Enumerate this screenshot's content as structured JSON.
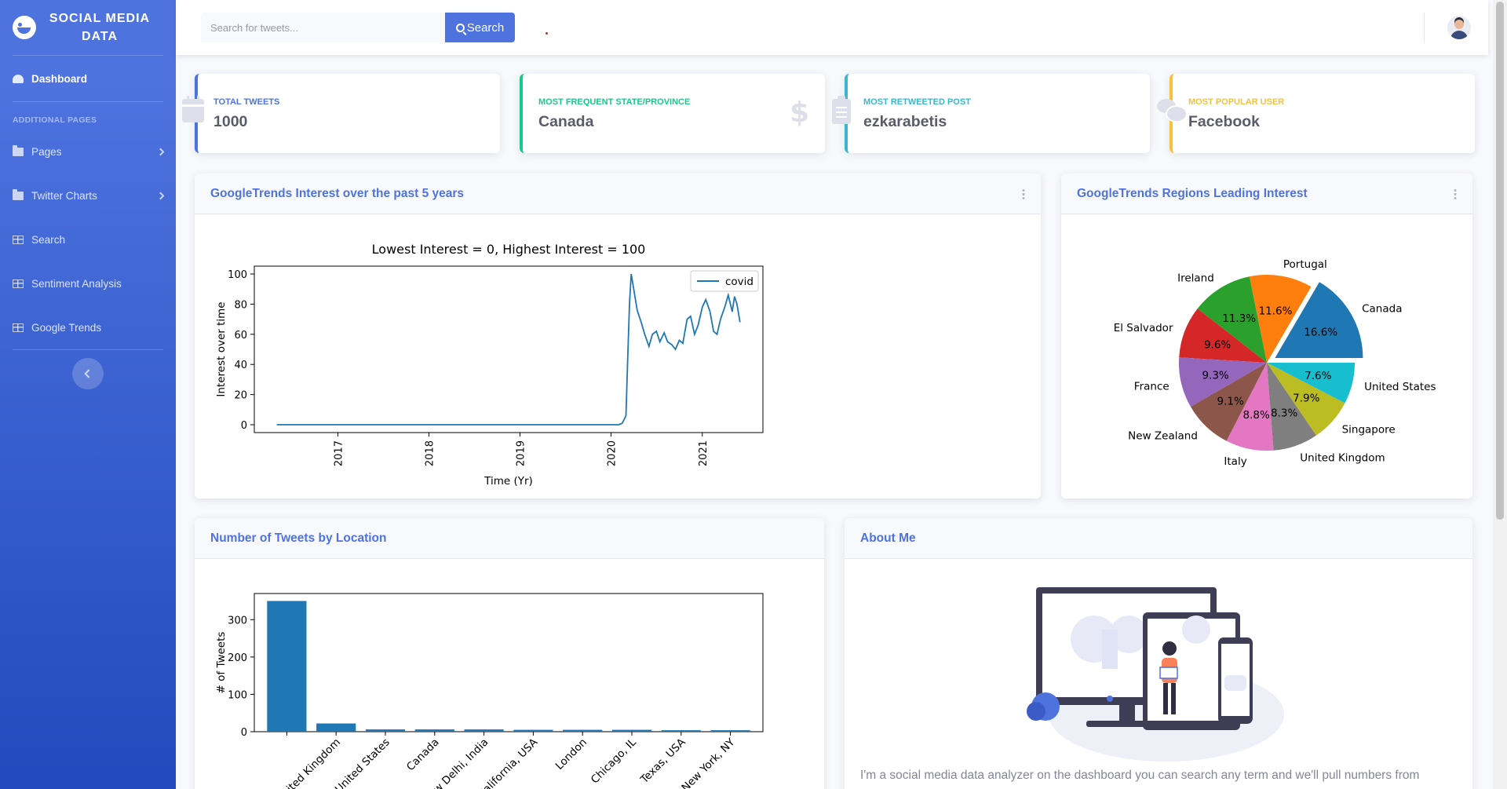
{
  "sidebar": {
    "brand": "SOCIAL MEDIA DATA",
    "items": [
      {
        "label": "Dashboard"
      },
      {
        "label": "Pages"
      },
      {
        "label": "Twitter Charts"
      },
      {
        "label": "Search"
      },
      {
        "label": "Sentiment Analysis"
      },
      {
        "label": "Google Trends"
      }
    ],
    "heading": "ADDITIONAL PAGES"
  },
  "topbar": {
    "search_placeholder": "Search for tweets...",
    "search_button": "Search"
  },
  "stats": [
    {
      "label": "TOTAL TWEETS",
      "value": "1000",
      "color": "#4e73df",
      "icon": "calendar-icon"
    },
    {
      "label": "MOST FREQUENT STATE/PROVINCE",
      "value": "Canada",
      "color": "#1cc88a",
      "icon": "dollar-icon"
    },
    {
      "label": "MOST RETWEETED POST",
      "value": "ezkarabetis",
      "color": "#36b9cc",
      "icon": "clipboard-icon"
    },
    {
      "label": "MOST POPULAR USER",
      "value": "Facebook",
      "color": "#f6c23e",
      "icon": "comments-icon"
    }
  ],
  "panels": {
    "trends_title": "GoogleTrends Interest over the past 5 years",
    "regions_title": "GoogleTrends Regions Leading Interest",
    "location_title": "Number of Tweets by Location",
    "about_title": "About Me",
    "about_text": "I'm a social media data analyzer on the dashboard you can search any term and we'll pull numbers from"
  },
  "chart_data": [
    {
      "type": "line",
      "title": "Lowest Interest = 0, Highest Interest = 100",
      "xlabel": "Time (Yr)",
      "ylabel": "Interest over time",
      "x_ticks": [
        "2017",
        "2018",
        "2019",
        "2020",
        "2021"
      ],
      "y_ticks": [
        0,
        20,
        40,
        60,
        80,
        100
      ],
      "ylim": [
        0,
        100
      ],
      "legend": "top-right",
      "series": [
        {
          "name": "covid",
          "color": "#1f77b4",
          "points": [
            [
              "2016-05-01",
              0
            ],
            [
              "2017-01-01",
              0
            ],
            [
              "2018-01-01",
              0
            ],
            [
              "2019-01-01",
              0
            ],
            [
              "2020-01-01",
              0
            ],
            [
              "2020-02-01",
              0
            ],
            [
              "2020-02-15",
              1
            ],
            [
              "2020-03-01",
              6
            ],
            [
              "2020-03-08",
              45
            ],
            [
              "2020-03-15",
              80
            ],
            [
              "2020-03-22",
              100
            ],
            [
              "2020-04-01",
              90
            ],
            [
              "2020-04-15",
              76
            ],
            [
              "2020-05-01",
              68
            ],
            [
              "2020-05-15",
              60
            ],
            [
              "2020-06-01",
              52
            ],
            [
              "2020-06-15",
              60
            ],
            [
              "2020-07-01",
              62
            ],
            [
              "2020-07-15",
              55
            ],
            [
              "2020-08-01",
              61
            ],
            [
              "2020-08-15",
              55
            ],
            [
              "2020-09-01",
              53
            ],
            [
              "2020-09-15",
              50
            ],
            [
              "2020-10-01",
              56
            ],
            [
              "2020-10-15",
              54
            ],
            [
              "2020-11-01",
              70
            ],
            [
              "2020-11-15",
              72
            ],
            [
              "2020-12-01",
              60
            ],
            [
              "2020-12-15",
              66
            ],
            [
              "2021-01-01",
              78
            ],
            [
              "2021-01-15",
              83
            ],
            [
              "2021-02-01",
              75
            ],
            [
              "2021-02-15",
              62
            ],
            [
              "2021-03-01",
              60
            ],
            [
              "2021-03-15",
              70
            ],
            [
              "2021-04-01",
              78
            ],
            [
              "2021-04-15",
              86
            ],
            [
              "2021-05-01",
              75
            ],
            [
              "2021-05-10",
              85
            ],
            [
              "2021-05-20",
              80
            ],
            [
              "2021-06-01",
              68
            ]
          ]
        }
      ]
    },
    {
      "type": "pie",
      "slices": [
        {
          "label": "Canada",
          "value": 16.6,
          "color": "#1f77b4"
        },
        {
          "label": "Portugal",
          "value": 11.6,
          "color": "#ff7f0e"
        },
        {
          "label": "Ireland",
          "value": 11.3,
          "color": "#2ca02c"
        },
        {
          "label": "El Salvador",
          "value": 9.6,
          "color": "#d62728"
        },
        {
          "label": "France",
          "value": 9.3,
          "color": "#9467bd"
        },
        {
          "label": "New Zealand",
          "value": 9.1,
          "color": "#8c564b"
        },
        {
          "label": "Italy",
          "value": 8.8,
          "color": "#e377c2"
        },
        {
          "label": "United Kingdom",
          "value": 8.3,
          "color": "#7f7f7f"
        },
        {
          "label": "Singapore",
          "value": 7.9,
          "color": "#bcbd22"
        },
        {
          "label": "United States",
          "value": 7.6,
          "color": "#17becf"
        }
      ],
      "pct_labels": [
        "16.6%",
        "11.6%",
        "11.3%",
        "9.6%",
        "9.3%",
        "9.1%",
        "8.8%",
        "8.3%",
        "7.9%",
        "7.6%"
      ]
    },
    {
      "type": "bar",
      "ylabel": "# of Tweets",
      "y_ticks": [
        0,
        100,
        200,
        300
      ],
      "ylim": [
        0,
        370
      ],
      "color": "#1f77b4",
      "categories": [
        "",
        "United Kingdom",
        "United States",
        "Canada",
        "New Delhi, India",
        "California, USA",
        "London",
        "Chicago, IL",
        "Texas, USA",
        "New York, NY"
      ],
      "values": [
        350,
        22,
        6,
        6,
        6,
        5,
        5,
        5,
        4,
        4
      ]
    }
  ]
}
